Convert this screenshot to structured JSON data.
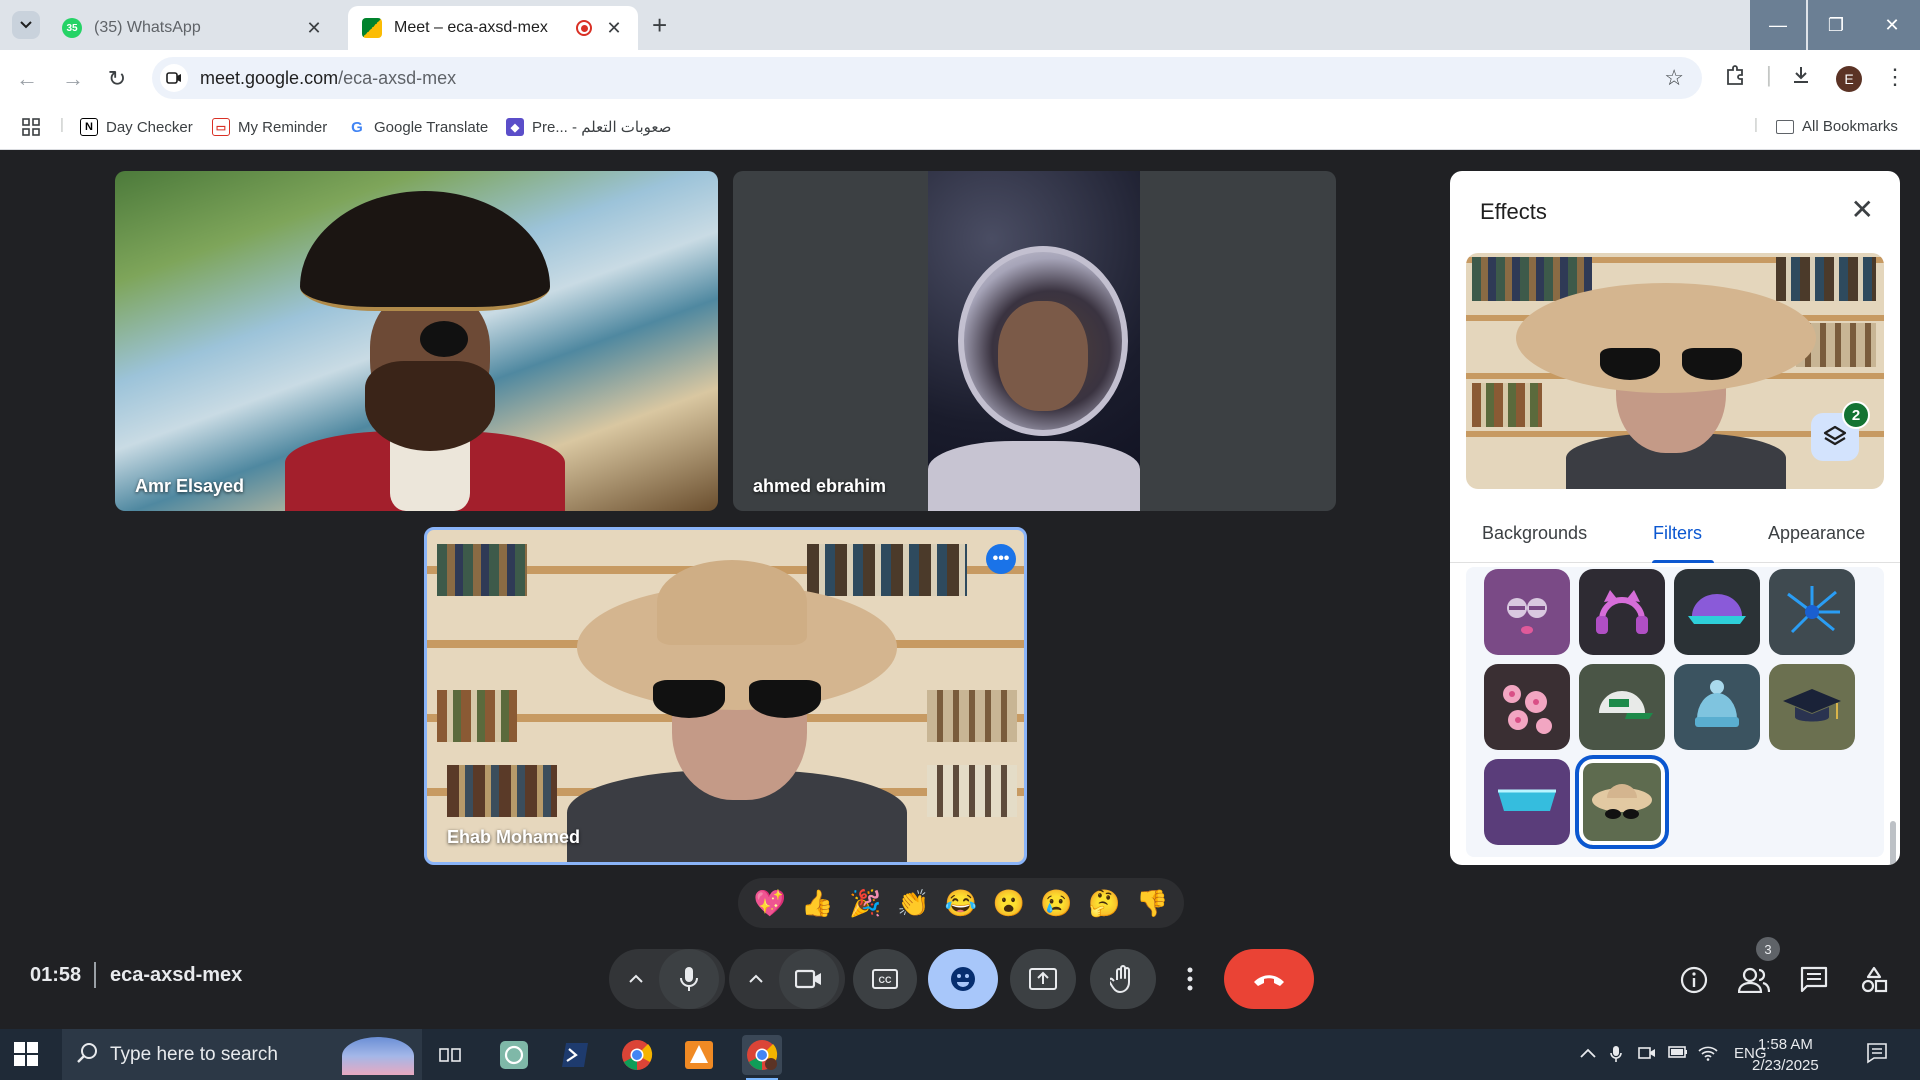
{
  "browser": {
    "tabs": [
      {
        "title": "(35) WhatsApp",
        "badge": "35",
        "active": false
      },
      {
        "title": "Meet – eca-axsd-mex",
        "active": true
      }
    ],
    "omnibox": {
      "domain": "meet.google.com",
      "path": "/eca-axsd-mex"
    },
    "profile_initial": "E",
    "bookmarks": [
      {
        "label": "Day Checker",
        "icon": "notion-icon"
      },
      {
        "label": "My Reminder",
        "icon": "clipboard-icon"
      },
      {
        "label": "Google Translate",
        "icon": "google-icon"
      },
      {
        "label": "Pre... - صعوبات التعلم",
        "icon": "app-icon"
      }
    ],
    "all_bookmarks": "All Bookmarks"
  },
  "meet": {
    "participants": [
      {
        "name": "Amr Elsayed",
        "effect": "pirate"
      },
      {
        "name": "ahmed ebrahim",
        "effect": "astronaut"
      },
      {
        "name": "Ehab Mohamed",
        "effect": "sun-hat-sunglasses",
        "self": true
      }
    ],
    "effects_panel": {
      "title": "Effects",
      "applied_count": "2",
      "tabs": [
        "Backgrounds",
        "Filters",
        "Appearance"
      ],
      "active_tab": "Filters",
      "filters": [
        {
          "name": "purple-face-filter",
          "color": "#7a4a86"
        },
        {
          "name": "cat-headphones-filter",
          "color": "#2e2b33"
        },
        {
          "name": "neon-cap-filter",
          "color": "#2b3236"
        },
        {
          "name": "blue-splash-filter",
          "color": "#3f4a50"
        },
        {
          "name": "cherry-blossom-filter",
          "color": "#3a2f33"
        },
        {
          "name": "baseball-cap-filter",
          "color": "#4a5546"
        },
        {
          "name": "beanie-filter",
          "color": "#3b5360"
        },
        {
          "name": "graduation-cap-filter",
          "color": "#6b7050"
        },
        {
          "name": "cyber-visor-filter",
          "color": "#5a3d7a"
        },
        {
          "name": "sun-hat-filter",
          "color": "#5e6b4f",
          "selected": true
        }
      ]
    },
    "reactions": [
      "💖",
      "👍",
      "🎉",
      "👏",
      "😂",
      "😮",
      "😢",
      "🤔",
      "👎"
    ],
    "timer": "01:58",
    "meeting_code": "eca-axsd-mex",
    "people_count": "3"
  },
  "taskbar": {
    "search_placeholder": "Type here to search",
    "language": "ENG",
    "time": "1:58 AM",
    "date": "2/23/2025"
  }
}
